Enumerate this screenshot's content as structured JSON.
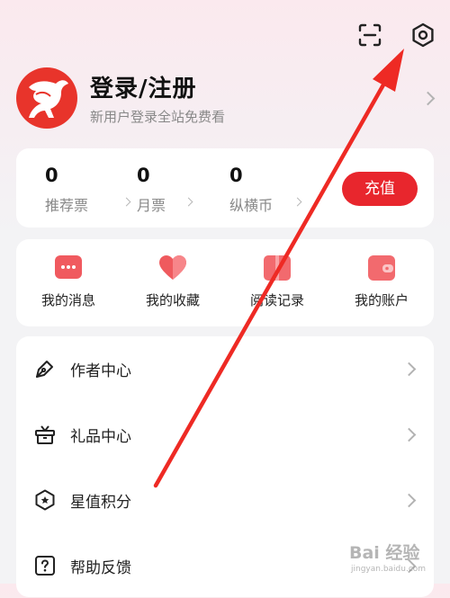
{
  "profile": {
    "title": "登录/注册",
    "subtitle": "新用户登录全站免费看"
  },
  "top_icons": [
    "scan-icon",
    "settings-icon"
  ],
  "stats": [
    {
      "value": "0",
      "label": "推荐票"
    },
    {
      "value": "0",
      "label": "月票"
    },
    {
      "value": "0",
      "label": "纵横币"
    }
  ],
  "recharge_label": "充值",
  "quick_actions": [
    {
      "label": "我的消息",
      "icon": "message-icon"
    },
    {
      "label": "我的收藏",
      "icon": "heart-icon"
    },
    {
      "label": "阅读记录",
      "icon": "book-icon"
    },
    {
      "label": "我的账户",
      "icon": "wallet-icon"
    }
  ],
  "menu": [
    {
      "label": "作者中心",
      "icon": "pen-icon"
    },
    {
      "label": "礼品中心",
      "icon": "gift-icon"
    },
    {
      "label": "星值积分",
      "icon": "star-badge-icon"
    },
    {
      "label": "帮助反馈",
      "icon": "help-icon"
    }
  ],
  "watermark": {
    "main": "Bai 经验",
    "sub": "jingyan.baidu.com"
  },
  "colors": {
    "accent": "#e8262d",
    "annotation_arrow": "#ee2a24"
  }
}
